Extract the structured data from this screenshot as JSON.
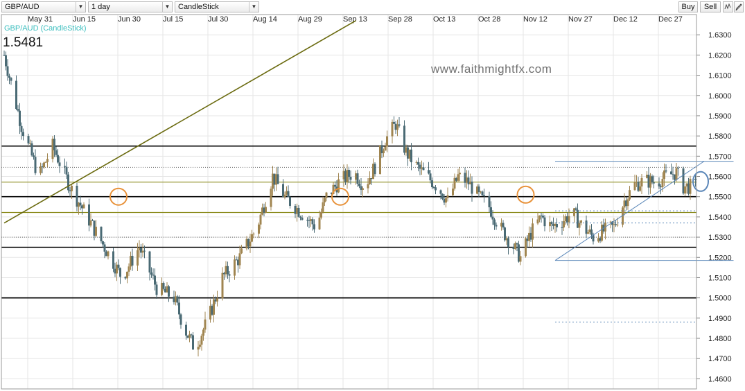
{
  "toolbar": {
    "symbol": "GBP/AUD",
    "interval": "1 day",
    "chart_type": "CandleStick",
    "buy_label": "Buy",
    "sell_label": "Sell",
    "dropdown_icon": "chevron-down-icon",
    "tools_icon": "indicator-icon",
    "draw_icon": "pencil-icon"
  },
  "legend": {
    "series_label": "GBP/AUD (CandleStick)",
    "last_price": "1.5481"
  },
  "watermark": "www.faithmightfx.com",
  "colors": {
    "up": "#a08550",
    "down": "#4a6a74",
    "olive": "#8a8a1a",
    "trendline": "#6b6b10",
    "blue": "#5a86b8",
    "orange": "#e8923a",
    "legend": "#3dbfbf"
  },
  "chart_data": {
    "type": "candlestick",
    "title": "GBP/AUD (CandleStick)",
    "ylim": [
      1.455,
      1.64
    ],
    "x_tick_labels": [
      "May 31",
      "Jun 15",
      "Jun 30",
      "Jul 15",
      "Jul 30",
      "Aug 14",
      "Aug 29",
      "Sep 13",
      "Sep 28",
      "Oct 13",
      "Oct 28",
      "Nov 12",
      "Nov 27",
      "Dec 12",
      "Dec 27"
    ],
    "y_tick_labels": [
      "1.6300",
      "1.6200",
      "1.6100",
      "1.6000",
      "1.5900",
      "1.5800",
      "1.5700",
      "1.5600",
      "1.5500",
      "1.5400",
      "1.5300",
      "1.5200",
      "1.5100",
      "1.5000",
      "1.4900",
      "1.4800",
      "1.4700",
      "1.4600"
    ],
    "last_price": 1.5481,
    "horizontal_levels_black": [
      1.575,
      1.55,
      1.525,
      1.5
    ],
    "horizontal_levels_olive": [
      1.5572,
      1.5422
    ],
    "dotted_levels": [
      1.5645,
      1.53
    ],
    "anchor_points": [
      [
        0,
        1.62
      ],
      [
        10,
        1.585
      ],
      [
        20,
        1.56
      ],
      [
        28,
        1.575
      ],
      [
        38,
        1.555
      ],
      [
        48,
        1.54
      ],
      [
        58,
        1.525
      ],
      [
        68,
        1.51
      ],
      [
        78,
        1.525
      ],
      [
        88,
        1.505
      ],
      [
        98,
        1.5
      ],
      [
        104,
        1.485
      ],
      [
        110,
        1.475
      ],
      [
        118,
        1.49
      ],
      [
        126,
        1.51
      ],
      [
        136,
        1.52
      ],
      [
        146,
        1.535
      ],
      [
        155,
        1.56
      ],
      [
        162,
        1.55
      ],
      [
        168,
        1.545
      ],
      [
        174,
        1.54
      ],
      [
        180,
        1.535
      ],
      [
        186,
        1.55
      ],
      [
        194,
        1.558
      ],
      [
        202,
        1.562
      ],
      [
        208,
        1.555
      ],
      [
        214,
        1.565
      ],
      [
        220,
        1.578
      ],
      [
        226,
        1.586
      ],
      [
        232,
        1.572
      ],
      [
        238,
        1.565
      ],
      [
        244,
        1.56
      ],
      [
        250,
        1.555
      ],
      [
        256,
        1.548
      ],
      [
        262,
        1.56
      ],
      [
        268,
        1.557
      ],
      [
        274,
        1.55
      ],
      [
        280,
        1.545
      ],
      [
        286,
        1.535
      ],
      [
        292,
        1.528
      ],
      [
        298,
        1.52
      ],
      [
        304,
        1.532
      ],
      [
        310,
        1.54
      ],
      [
        316,
        1.535
      ],
      [
        322,
        1.538
      ],
      [
        328,
        1.542
      ],
      [
        334,
        1.535
      ],
      [
        340,
        1.53
      ],
      [
        346,
        1.533
      ],
      [
        352,
        1.535
      ],
      [
        358,
        1.548
      ],
      [
        364,
        1.556
      ],
      [
        370,
        1.558
      ],
      [
        376,
        1.557
      ],
      [
        382,
        1.56
      ],
      [
        388,
        1.562
      ],
      [
        392,
        1.555
      ]
    ],
    "trendline": {
      "from": [
        0,
        1.537
      ],
      "to": [
        203,
        1.637
      ]
    },
    "channel": {
      "top": [
        [
          318,
          1.5675
        ],
        [
          421,
          1.5675
        ]
      ],
      "bottom": [
        [
          318,
          1.5185
        ],
        [
          421,
          1.5185
        ]
      ],
      "diagonal": [
        [
          318,
          1.5185
        ],
        [
          404,
          1.5675
        ]
      ]
    },
    "dashed_levels": [
      1.543,
      1.537,
      1.488
    ],
    "orange_circles": [
      [
        66,
        1.55
      ],
      [
        194,
        1.55
      ],
      [
        301,
        1.551
      ]
    ],
    "blue_circle": [
      402,
      1.5575
    ],
    "grid": true,
    "legend_position": "top-left"
  }
}
